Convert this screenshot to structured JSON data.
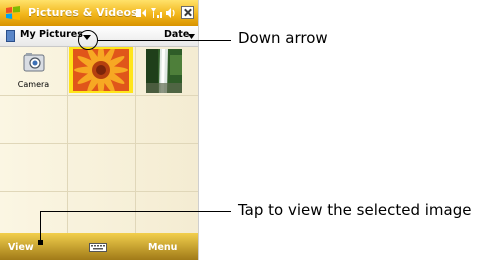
{
  "titlebar": {
    "app_title": "Pictures & Videos",
    "start_icon": "windows-flag-icon",
    "status_icons": [
      "connectivity-icon",
      "signal-icon",
      "volume-icon"
    ],
    "close_icon": "close-icon"
  },
  "toolbar": {
    "folder_label": "My Pictures",
    "folder_dropdown_icon": "chevron-down-icon",
    "sort_label": "Date"
  },
  "grid": {
    "camera_label": "Camera",
    "items": [
      "camera-icon",
      "flower-thumbnail",
      "waterfall-thumbnail"
    ],
    "selected_item": "flower-thumbnail"
  },
  "softkeys": {
    "left": "View",
    "center_icon": "keyboard-icon",
    "right": "Menu"
  },
  "annotations": {
    "down_arrow": "Down arrow",
    "view_selected": "Tap to view the selected image"
  },
  "colors": {
    "titlebar": "#f2b61c",
    "selection": "#ffe51a",
    "grid_background": "#f8f1dc"
  }
}
